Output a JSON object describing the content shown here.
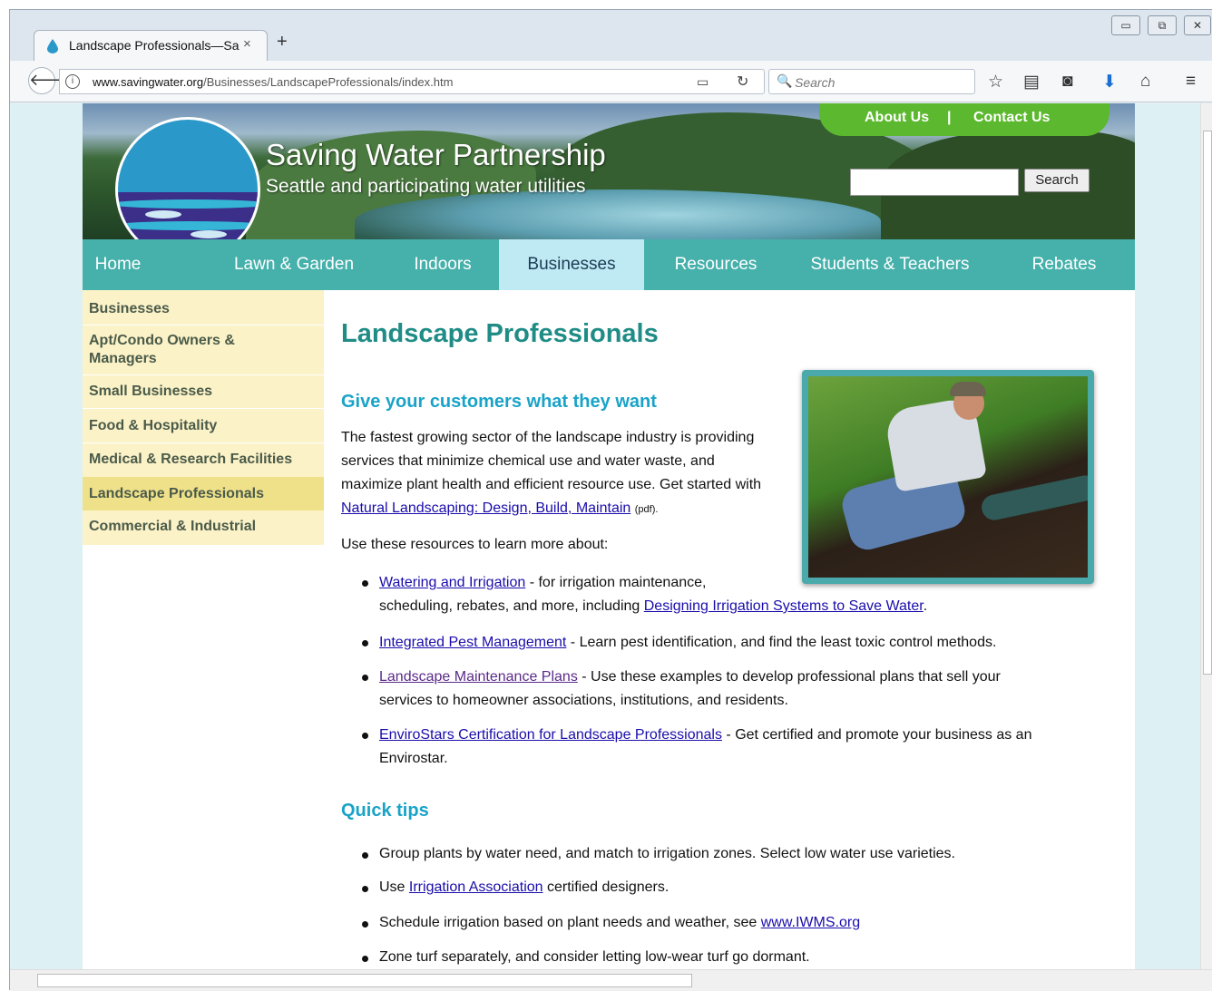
{
  "browser": {
    "tab_title": "Landscape Professionals—Sa",
    "tab_close": "×",
    "new_tab": "+",
    "url_domain": "www.savingwater.org",
    "url_path": "/Businesses/LandscapeProfessionals/index.htm",
    "search_placeholder": "Search",
    "window_controls": [
      "▭",
      "⧉",
      "✕"
    ]
  },
  "header": {
    "title": "Saving Water Partnership",
    "subtitle": "Seattle and participating water utilities",
    "about": "About Us",
    "divider": "|",
    "contact": "Contact Us",
    "search_button": "Search"
  },
  "nav": [
    "Home",
    "Lawn & Garden",
    "Indoors",
    "Businesses",
    "Resources",
    "Students & Teachers",
    "Rebates"
  ],
  "sidebar": [
    "Businesses",
    "Apt/Condo Owners &",
    "Managers",
    "Small Businesses",
    "Food & Hospitality",
    "Medical & Research Facilities",
    "Landscape Professionals",
    "Commercial & Industrial"
  ],
  "content": {
    "title": "Landscape Professionals",
    "section1": "Give your customers what they want",
    "intro_lines": [
      "The fastest growing sector of the landscape industry is providing",
      "services that minimize chemical use and water waste, and",
      "maximize plant health and efficient resource use. Get started with"
    ],
    "intro_link": "Natural Landscaping: Design, Build, Maintain",
    "intro_pdf": "(pdf).",
    "resources_intro": "Use these resources to learn more about:",
    "resources": {
      "r1_link": "Watering and Irrigation",
      "r1_text": " - for irrigation maintenance,",
      "r1_line2": "scheduling, rebates, and more, including ",
      "r1_link2": "Designing Irrigation Systems to Save Water",
      "r1_end": ".",
      "r2_link": "Integrated Pest Management",
      "r2_text": " - Learn pest identification, and find the least toxic control methods.",
      "r3_link": "Landscape Maintenance Plans",
      "r3_text": " - Use these examples to develop professional plans that sell your",
      "r3_line2": "services to homeowner associations, institutions, and residents.",
      "r4_link": "EnviroStars Certification for Landscape Professionals",
      "r4_text": " - Get certified and promote your business as an",
      "r4_line2": "Envirostar."
    },
    "section2": "Quick tips",
    "tips": {
      "t1": "Group plants by water need, and match to irrigation zones. Select low water use varieties.",
      "t2_pre": "Use ",
      "t2_link": "Irrigation Association",
      "t2_post": " certified designers.",
      "t3_pre": "Schedule irrigation based on plant needs and weather, see ",
      "t3_link": "www.IWMS.org",
      "t4": "Zone turf separately, and consider letting low-wear turf go dormant."
    }
  },
  "colors": {
    "nav": "#46b0ab",
    "nav_active": "#bfe9f3",
    "sidebar": "#fcf2c7",
    "heading": "#1f8c86",
    "subheading": "#1aa3c8",
    "toplinks": "#5cb82e"
  }
}
